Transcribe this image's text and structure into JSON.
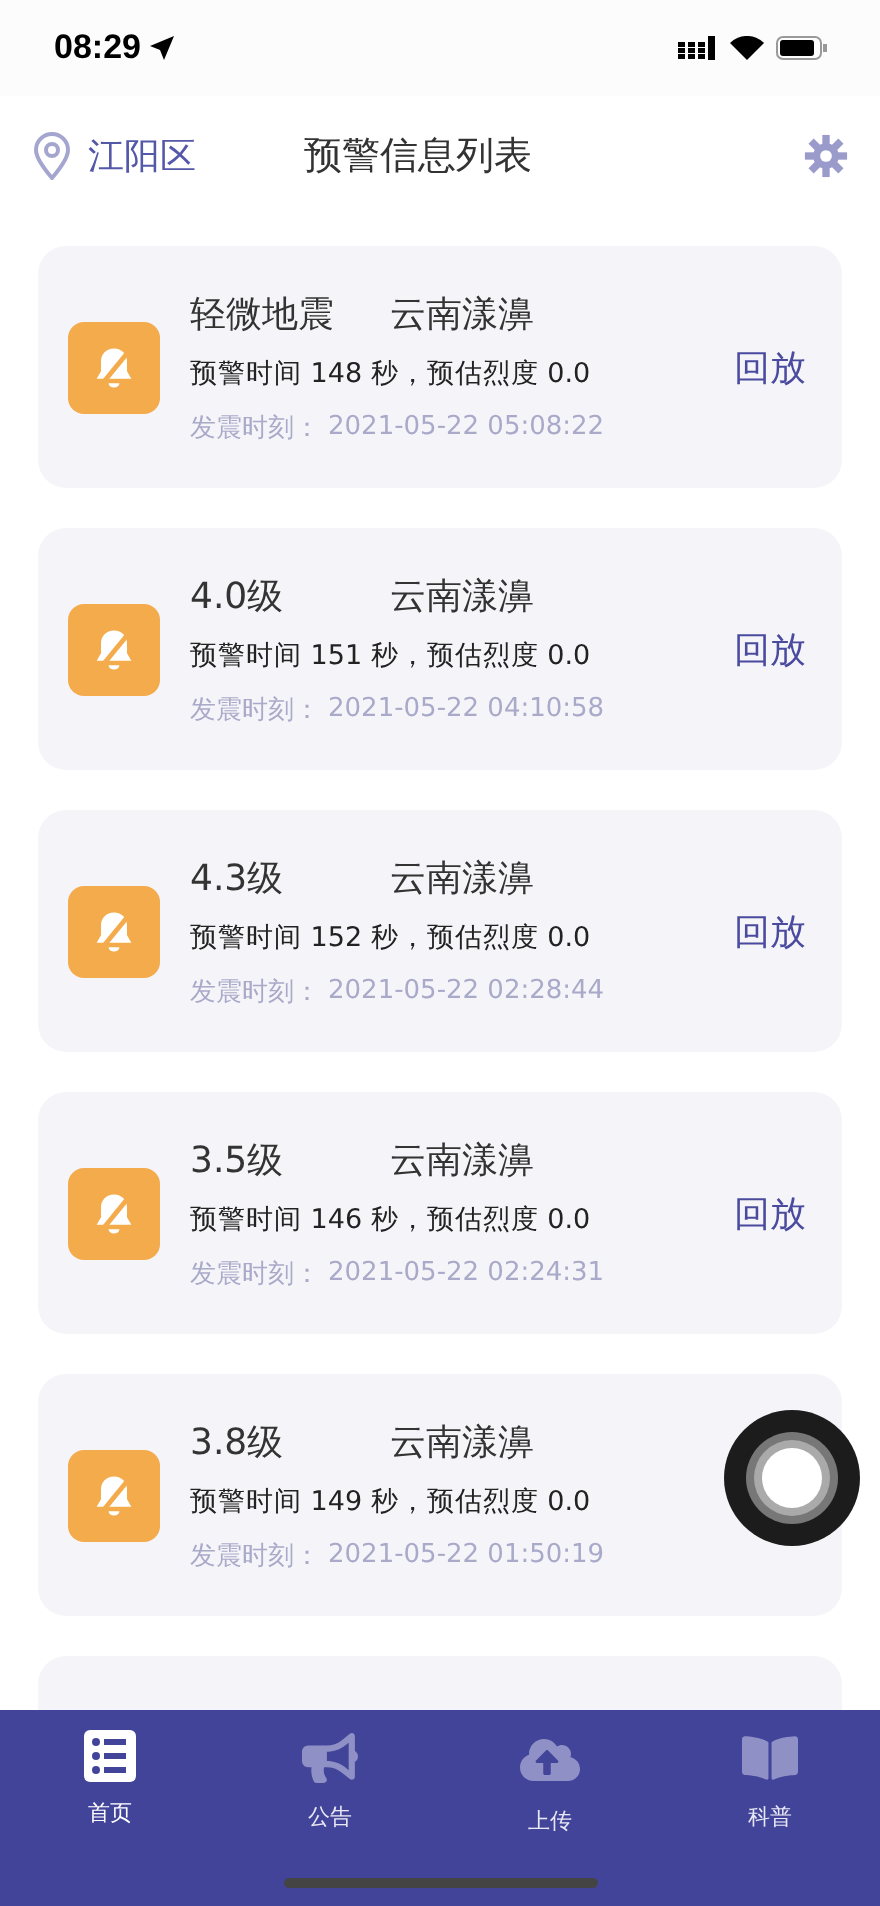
{
  "status_bar": {
    "time": "08:29"
  },
  "header": {
    "location": "江阳区",
    "title": "预警信息列表"
  },
  "alerts": [
    {
      "kind": "card",
      "magnitude": "轻微地震",
      "place": "云南漾濞",
      "warning": "预警时间 148 秒，预估烈度 0.0",
      "time_label": "发震时刻：",
      "time": "2021-05-22 05:08:22",
      "action": "回放"
    },
    {
      "kind": "card",
      "magnitude": "4.0级",
      "place": "云南漾濞",
      "warning": "预警时间 151 秒，预估烈度 0.0",
      "time_label": "发震时刻：",
      "time": "2021-05-22 04:10:58",
      "action": "回放"
    },
    {
      "kind": "card",
      "magnitude": "4.3级",
      "place": "云南漾濞",
      "warning": "预警时间 152 秒，预估烈度 0.0",
      "time_label": "发震时刻：",
      "time": "2021-05-22 02:28:44",
      "action": "回放"
    },
    {
      "kind": "card",
      "magnitude": "3.5级",
      "place": "云南漾濞",
      "warning": "预警时间 146 秒，预估烈度 0.0",
      "time_label": "发震时刻：",
      "time": "2021-05-22 02:24:31",
      "action": "回放"
    },
    {
      "kind": "card",
      "magnitude": "3.8级",
      "place": "云南漾濞",
      "warning": "预警时间 149 秒，预估烈度 0.0",
      "time_label": "发震时刻：",
      "time": "2021-05-22 01:50:19"
    },
    {
      "kind": "partial"
    }
  ],
  "tabs": [
    {
      "label": "首页",
      "kind": "list",
      "selected": true
    },
    {
      "label": "公告",
      "kind": "notice",
      "selected": false
    },
    {
      "label": "上传",
      "kind": "upload",
      "selected": false
    },
    {
      "label": "科普",
      "kind": "book",
      "selected": false
    }
  ]
}
